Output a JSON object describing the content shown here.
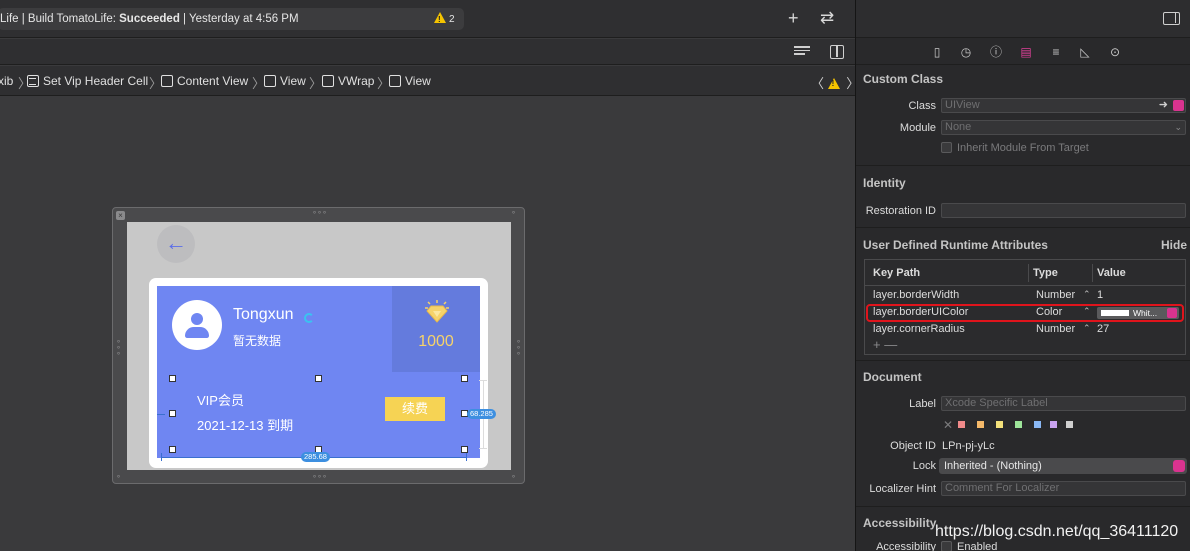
{
  "toolbar": {
    "status_prefix": "Life | Build TomatoLife: ",
    "status_result": "Succeeded",
    "status_suffix": " | Yesterday at 4:56 PM",
    "warning_count": "2"
  },
  "breadcrumb": {
    "items": [
      "xib",
      "Set Vip Header Cell",
      "Content View",
      "View",
      "VWrap",
      "View"
    ]
  },
  "canvas": {
    "back_arrow": "←",
    "username": "Tongxun",
    "no_data": "暂无数据",
    "points": "1000",
    "vip_label": "VIP会员",
    "expiry": "2021-12-13 到期",
    "renew_button": "续费",
    "width_badge": "285.68",
    "height_badge": "68.285"
  },
  "inspector": {
    "custom_class": {
      "title": "Custom Class",
      "class_label": "Class",
      "class_placeholder": "UIView",
      "module_label": "Module",
      "module_placeholder": "None",
      "inherit_label": "Inherit Module From Target"
    },
    "identity": {
      "title": "Identity",
      "restoration_label": "Restoration ID",
      "restoration_value": ""
    },
    "runtime": {
      "title": "User Defined Runtime Attributes",
      "hide_label": "Hide",
      "col_key": "Key Path",
      "col_type": "Type",
      "col_value": "Value",
      "rows": [
        {
          "key": "layer.borderWidth",
          "type": "Number",
          "value": "1"
        },
        {
          "key": "layer.borderUIColor",
          "type": "Color",
          "value": "Whit..."
        },
        {
          "key": "layer.cornerRadius",
          "type": "Number",
          "value": "27"
        }
      ],
      "add_remove": "+ —"
    },
    "document": {
      "title": "Document",
      "label_label": "Label",
      "label_placeholder": "Xcode Specific Label",
      "clear_mark": "✕",
      "label_colors": [
        "#f08a8a",
        "#f5b96a",
        "#f3e07a",
        "#9ee59a",
        "#8ab8f5",
        "#c9a3f0",
        "#cfcfcf"
      ],
      "object_id_label": "Object ID",
      "object_id_value": "LPn-pj-yLc",
      "lock_label": "Lock",
      "lock_value": "Inherited - (Nothing)",
      "localizer_label": "Localizer Hint",
      "localizer_placeholder": "Comment For Localizer"
    },
    "accessibility": {
      "title": "Accessibility",
      "accessibility_label": "Accessibility",
      "enabled_label": "Enabled"
    }
  },
  "watermark": "https://blog.csdn.net/qq_36411120",
  "colors": {
    "card_blue": "#6f86f2",
    "renew_yellow": "#f6d354",
    "highlight_red": "#e0141c",
    "accent_pink": "#d9338f"
  }
}
